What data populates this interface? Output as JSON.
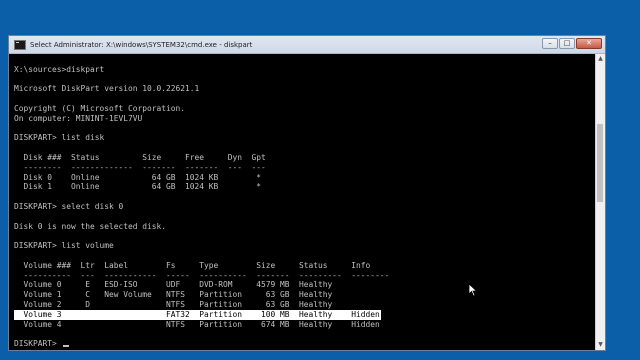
{
  "window": {
    "title": "Select Administrator: X:\\windows\\SYSTEM32\\cmd.exe - diskpart",
    "controls": {
      "minimize": "–",
      "maximize": "□",
      "close": "✕"
    }
  },
  "console": {
    "lines": [
      "",
      "X:\\sources>diskpart",
      "",
      "Microsoft DiskPart version 10.0.22621.1",
      "",
      "Copyright (C) Microsoft Corporation.",
      "On computer: MININT-1EVL7VU",
      "",
      "DISKPART> list disk",
      "",
      "  Disk ###  Status         Size     Free     Dyn  Gpt",
      "  --------  -------------  -------  -------  ---  ---",
      "  Disk 0    Online           64 GB  1024 KB        *",
      "  Disk 1    Online           64 GB  1024 KB        *",
      "",
      "DISKPART> select disk 0",
      "",
      "Disk 0 is now the selected disk.",
      "",
      "DISKPART> list volume",
      "",
      "  Volume ###  Ltr  Label        Fs     Type        Size     Status     Info",
      "  ----------  ---  -----------  -----  ----------  -------  ---------  --------",
      "  Volume 0     E   ESD-ISO      UDF    DVD-ROM     4579 MB  Healthy",
      "  Volume 1     C   New Volume   NTFS   Partition     63 GB  Healthy",
      "  Volume 2     D                NTFS   Partition     63 GB  Healthy",
      "  Volume 3                      FAT32  Partition    100 MB  Healthy    Hidden",
      "  Volume 4                      NTFS   Partition    674 MB  Healthy    Hidden",
      "",
      "DISKPART> "
    ],
    "selected_line_index": 26,
    "prompt_line_index": 29
  },
  "colors": {
    "desktop_background": "#0b5fa8",
    "console_background": "#000000",
    "console_text": "#c0c0c0",
    "selection_background": "#ffffff",
    "selection_text": "#000000"
  },
  "icons": {
    "app": "cmd-icon",
    "scroll_up": "arrow-up-icon",
    "scroll_down": "arrow-down-icon",
    "pointer": "mouse-pointer-icon"
  }
}
